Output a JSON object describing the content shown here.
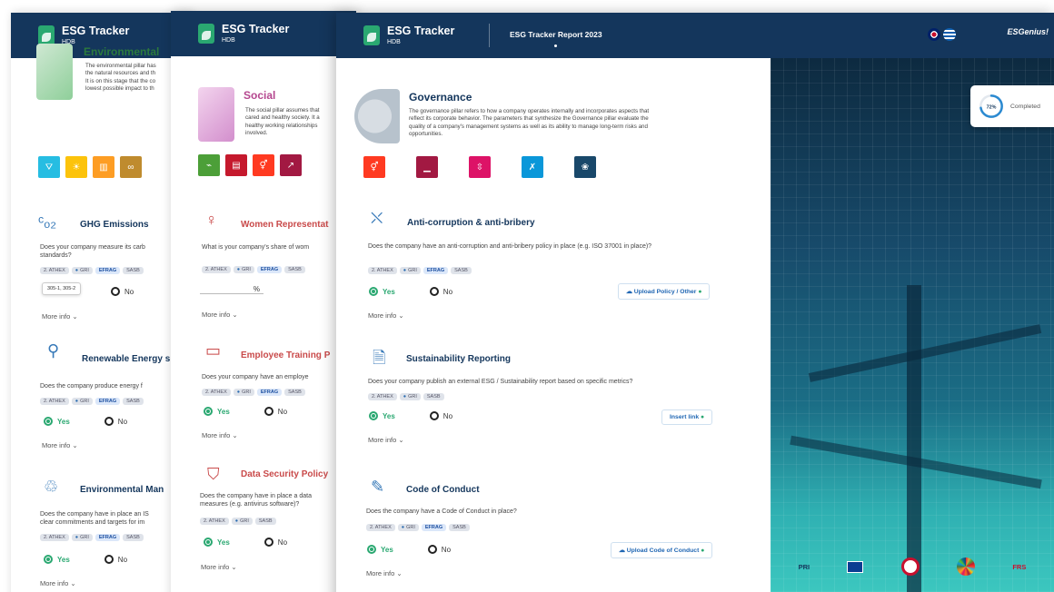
{
  "brand": {
    "name": "ESG Tracker",
    "sub": "HDB"
  },
  "report_title": "ESG Tracker Report 2023",
  "header_right": {
    "logo": "ESGenius!"
  },
  "tag_labels": {
    "athex": "2. ATHEX",
    "gri": "GRI",
    "efrag": "EFRAG",
    "sasb": "SASB"
  },
  "answers": {
    "yes": "Yes",
    "no": "No"
  },
  "more_info": "More info",
  "environmental": {
    "title": "Environmental",
    "desc": "The environmental pillar has\nthe natural resources and th\nIt is on this stage that the co\nlowest possible impact to th",
    "sections": [
      {
        "title": "GHG Emissions",
        "question": "Does your company measure its carb\nstandards?",
        "tooltip": "305-1, 305-2"
      },
      {
        "title": "Renewable Energy s",
        "question": "Does the company produce energy f"
      },
      {
        "title": "Environmental Man",
        "question": "Does the company have in place an IS\nclear commitments and targets for im"
      }
    ]
  },
  "social": {
    "title": "Social",
    "desc": "The social pillar assumes that\ncared and healthy society. It a\nhealthy working relationships\ninvolved.",
    "sections": [
      {
        "title": "Women Representat",
        "question": "What is your company's share of wom",
        "unit": "%"
      },
      {
        "title": "Employee Training P",
        "question": "Does your company have an employe"
      },
      {
        "title": "Data Security Policy",
        "question": "Does the company have in place a data\nmeasures (e.g. antivirus software)?"
      }
    ]
  },
  "governance": {
    "title": "Governance",
    "desc": "The governance pillar refers to how a company operates internally and incorporates aspects that\nreflect its corporate behavior. The parameters that synthesize the Governance pillar evaluate the\nquality of a company's management systems as well as its ability to manage long-term risks and\nopportunities.",
    "sections": [
      {
        "title": "Anti-corruption & anti-bribery",
        "question": "Does the company have an anti-corruption and anti-bribery policy in place (e.g. ISO 37001 in place)?",
        "action": "Upload Policy / Other"
      },
      {
        "title": "Sustainability Reporting",
        "question": "Does your company publish an external ESG / Sustainability report based on specific metrics?",
        "action": "Insert link"
      },
      {
        "title": "Code of Conduct",
        "question": "Does the company have a Code of Conduct in place?",
        "action": "Upload Code of Conduct"
      }
    ]
  },
  "progress": {
    "value": "72%",
    "label": "Completed",
    "fraction": 0.72
  },
  "partners": [
    "PRI",
    "EU",
    "Seal",
    "SDG",
    "FRS"
  ],
  "colors": {
    "navy": "#14365c",
    "green": "#2aa871",
    "env": "#2b7a3d",
    "soc": "#b5478f",
    "gov": "#14365c"
  }
}
